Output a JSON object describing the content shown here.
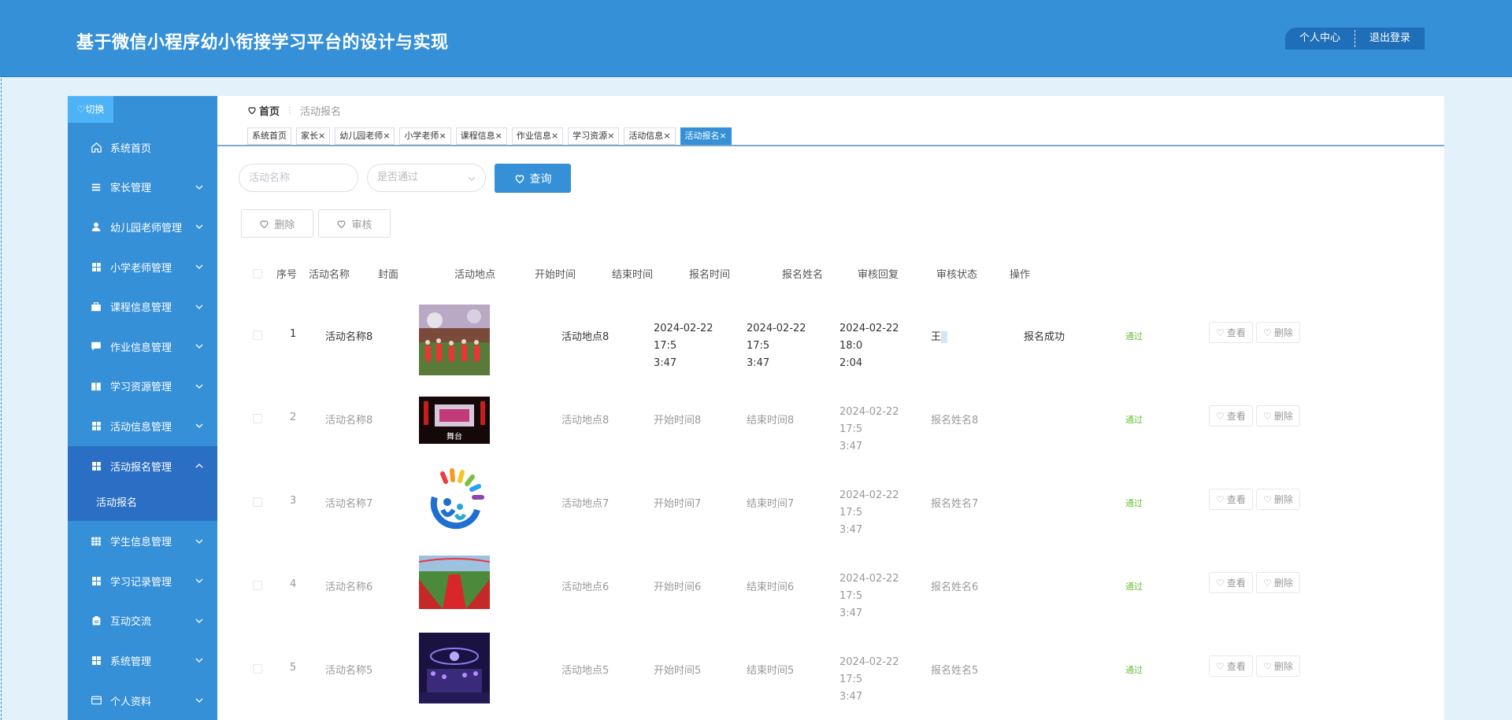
{
  "header": {
    "title": "基于微信小程序幼小衔接学习平台的设计与实现",
    "profile_label": "个人中心",
    "logout_label": "退出登录"
  },
  "sidebar": {
    "switch_label": "切换",
    "items": [
      {
        "label": "系统首页",
        "icon": "home-icon",
        "chevron": false
      },
      {
        "label": "家长管理",
        "icon": "list-icon",
        "chevron": true
      },
      {
        "label": "幼儿园老师管理",
        "icon": "user-icon",
        "chevron": true
      },
      {
        "label": "小学老师管理",
        "icon": "grid-icon",
        "chevron": true
      },
      {
        "label": "课程信息管理",
        "icon": "briefcase-icon",
        "chevron": true
      },
      {
        "label": "作业信息管理",
        "icon": "chat-icon",
        "chevron": true
      },
      {
        "label": "学习资源管理",
        "icon": "book-icon",
        "chevron": true
      },
      {
        "label": "活动信息管理",
        "icon": "grid-icon",
        "chevron": true
      },
      {
        "label": "活动报名管理",
        "icon": "grid-icon",
        "chevron": true,
        "active": true
      },
      {
        "label": "学生信息管理",
        "icon": "table-icon",
        "chevron": true
      },
      {
        "label": "学习记录管理",
        "icon": "grid-icon",
        "chevron": true
      },
      {
        "label": "互动交流",
        "icon": "clipboard-icon",
        "chevron": true
      },
      {
        "label": "系统管理",
        "icon": "grid-icon",
        "chevron": true
      },
      {
        "label": "个人资料",
        "icon": "card-icon",
        "chevron": true
      }
    ],
    "submenu_label": "活动报名"
  },
  "breadcrumb": {
    "home": "首页",
    "current": "活动报名"
  },
  "tabs": [
    {
      "label": "系统首页",
      "closable": false
    },
    {
      "label": "家长",
      "closable": true
    },
    {
      "label": "幼儿园老师",
      "closable": true
    },
    {
      "label": "小学老师",
      "closable": true
    },
    {
      "label": "课程信息",
      "closable": true
    },
    {
      "label": "作业信息",
      "closable": true
    },
    {
      "label": "学习资源",
      "closable": true
    },
    {
      "label": "活动信息",
      "closable": true
    },
    {
      "label": "活动报名",
      "closable": true,
      "active": true
    }
  ],
  "search": {
    "name_placeholder": "活动名称",
    "status_placeholder": "是否通过",
    "query_label": "查询"
  },
  "actions": {
    "delete_label": "删除",
    "audit_label": "审核"
  },
  "table": {
    "columns": [
      "序号",
      "活动名称",
      "封面",
      "活动地点",
      "开始时间",
      "结束时间",
      "报名时间",
      "报名姓名",
      "审核回复",
      "审核状态",
      "操作"
    ],
    "rows": [
      {
        "index": "1",
        "name": "活动名称8",
        "place": "活动地点8",
        "start": [
          "2024-02-22 17:5",
          "3:47"
        ],
        "end": [
          "2024-02-22 17:5",
          "3:47"
        ],
        "signup": [
          "2024-02-22 18:0",
          "2:04"
        ],
        "person_a": "王",
        "person_b": "  ",
        "reply": "报名成功",
        "status": "通过"
      },
      {
        "index": "2",
        "name": "活动名称8",
        "place": "活动地点8",
        "start": [
          "开始时间8",
          ""
        ],
        "end": [
          "结束时间8",
          ""
        ],
        "signup": [
          "2024-02-22 17:5",
          "3:47"
        ],
        "person_a": "报名姓名8",
        "person_b": "",
        "reply": "",
        "status": "通过"
      },
      {
        "index": "3",
        "name": "活动名称7",
        "place": "活动地点7",
        "start": [
          "开始时间7",
          ""
        ],
        "end": [
          "结束时间7",
          ""
        ],
        "signup": [
          "2024-02-22 17:5",
          "3:47"
        ],
        "person_a": "报名姓名7",
        "person_b": "",
        "reply": "",
        "status": "通过"
      },
      {
        "index": "4",
        "name": "活动名称6",
        "place": "活动地点6",
        "start": [
          "开始时间6",
          ""
        ],
        "end": [
          "结束时间6",
          ""
        ],
        "signup": [
          "2024-02-22 17:5",
          "3:47"
        ],
        "person_a": "报名姓名6",
        "person_b": "",
        "reply": "",
        "status": "通过"
      },
      {
        "index": "5",
        "name": "活动名称5",
        "place": "活动地点5",
        "start": [
          "开始时间5",
          ""
        ],
        "end": [
          "结束时间5",
          ""
        ],
        "signup": [
          "2024-02-22 17:5",
          "3:47"
        ],
        "person_a": "报名姓名5",
        "person_b": "",
        "reply": "",
        "status": "通过"
      }
    ],
    "view_label": "查看",
    "delete_label": "删除"
  },
  "colors": {
    "primary": "#3590d8",
    "sidebar_active": "#2a6fc4",
    "success": "#67c23a",
    "page_bg": "#e3f1fb"
  }
}
